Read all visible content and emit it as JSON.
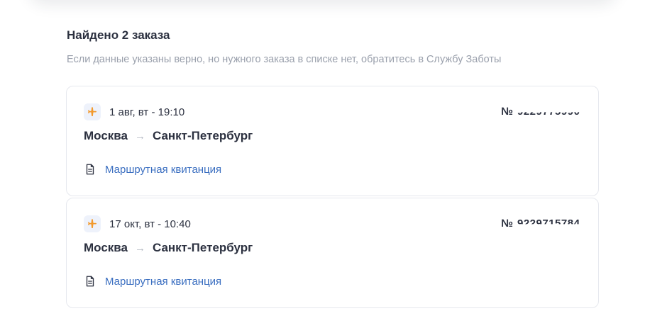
{
  "header": {
    "title": "Найдено 2 заказа",
    "subtitle": "Если данные указаны верно, но нужного заказа в списке нет, обратитесь в Службу Заботы"
  },
  "orders": [
    {
      "date": "1 авг, вт - 19:10",
      "from": "Москва",
      "arrow": "→",
      "to": "Санкт-Петербург",
      "order_prefix": "№",
      "order_number": "9229775990",
      "receipt_label": "Маршрутная квитанция"
    },
    {
      "date": "17 окт, вт - 10:40",
      "from": "Москва",
      "arrow": "→",
      "to": "Санкт-Петербург",
      "order_prefix": "№",
      "order_number": "9229715784",
      "receipt_label": "Маршрутная квитанция"
    }
  ],
  "colors": {
    "accent_plane": "#f29a2e",
    "link": "#3a6ec0",
    "text": "#2c3140",
    "muted": "#9aa0ac"
  },
  "icons": [
    "airplane-icon",
    "document-icon"
  ]
}
